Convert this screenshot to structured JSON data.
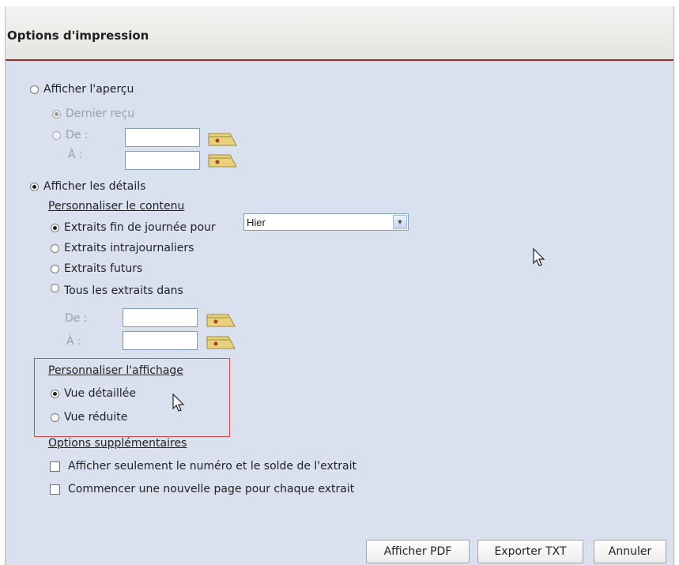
{
  "dialog": {
    "title": "Options d'impression"
  },
  "preview": {
    "label": "Afficher l'aperçu",
    "last_receipt_label": "Dernier reçu",
    "from_label": "De :",
    "to_label": "À :",
    "from_value": "",
    "to_value": ""
  },
  "details": {
    "label": "Afficher les détails",
    "customize_content_label": "Personnaliser le contenu",
    "end_of_day_label": "Extraits fin de journée pour",
    "end_of_day_select_value": "Hier",
    "intraday_label": "Extraits intrajournaliers",
    "future_label": "Extraits futurs",
    "all_in_label": "Tous les extraits dans",
    "from_label": "De :",
    "to_label": "À :",
    "from_value": "",
    "to_value": ""
  },
  "display": {
    "customize_display_label": "Personnaliser l'affichage",
    "detailed_view_label": "Vue détaillée",
    "reduced_view_label": "Vue réduite"
  },
  "extra": {
    "extra_options_label": "Options supplémentaires",
    "only_number_balance_label": "Afficher seulement le numéro et le solde de l'extrait",
    "new_page_label": "Commencer une nouvelle page pour chaque extrait"
  },
  "buttons": {
    "pdf_label": "Afficher PDF",
    "txt_label": "Exporter TXT",
    "cancel_label": "Annuler"
  },
  "colors": {
    "dialog_bg": "#d9e1ef",
    "title_underline": "#9c2a2a",
    "highlight_box": "#d84545"
  }
}
